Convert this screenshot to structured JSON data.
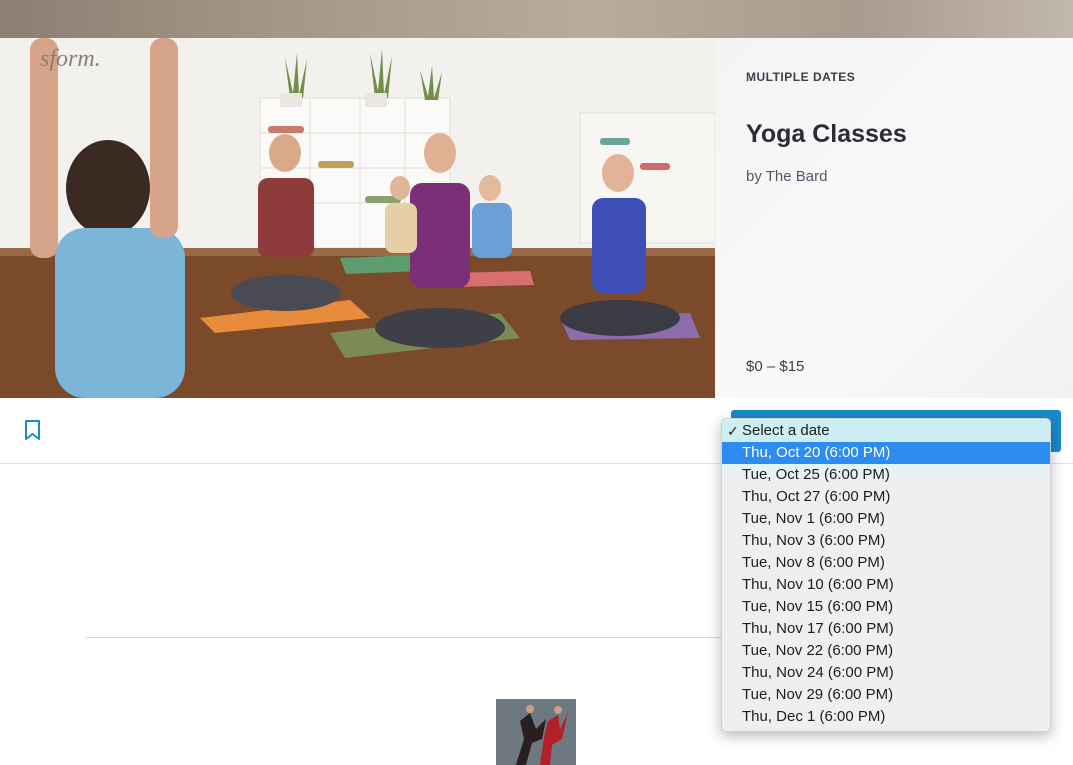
{
  "event": {
    "eyebrow": "MULTIPLE DATES",
    "title": "Yoga Classes",
    "byline": "by The Bard",
    "price": "$0 – $15"
  },
  "image": {
    "partial_text": "sform."
  },
  "icons": {
    "bookmark": "bookmark-icon",
    "check": "checkmark-icon"
  },
  "colors": {
    "ticket_button": "#1a8acb",
    "dropdown_highlight": "#2d8cf0",
    "title_text": "#2c2c38"
  },
  "date_select": {
    "selected_label": "Select a date",
    "check_glyph": "✓",
    "highlighted_option": "Thu, Oct 20 (6:00 PM)",
    "options": [
      "Thu, Oct 20 (6:00 PM)",
      "Tue, Oct 25 (6:00 PM)",
      "Thu, Oct 27 (6:00 PM)",
      "Tue, Nov 1 (6:00 PM)",
      "Thu, Nov 3 (6:00 PM)",
      "Tue, Nov 8 (6:00 PM)",
      "Thu, Nov 10 (6:00 PM)",
      "Tue, Nov 15 (6:00 PM)",
      "Thu, Nov 17 (6:00 PM)",
      "Tue, Nov 22 (6:00 PM)",
      "Thu, Nov 24 (6:00 PM)",
      "Tue, Nov 29 (6:00 PM)",
      "Thu, Dec 1 (6:00 PM)"
    ]
  }
}
